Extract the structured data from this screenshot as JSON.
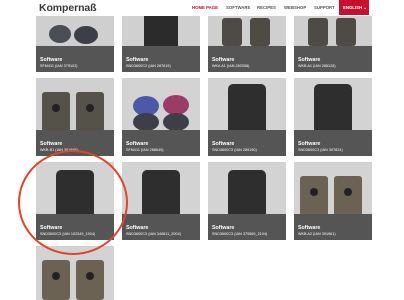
{
  "header": {
    "logo": "Kompernaß",
    "nav": [
      "HOME PAGE",
      "SOFTWARE",
      "RECIPES",
      "WEBSHOP",
      "SUPPORT"
    ],
    "language": "ENGLISH ⌄"
  },
  "tiles": [
    {
      "title": "Software",
      "subtitle": "SFM411 (IAN 379102)",
      "icon": "mouse-icon"
    },
    {
      "title": "Software",
      "subtitle": "SND3600C2 (IAN 287615)",
      "icon": "nas-icon"
    },
    {
      "title": "Software",
      "subtitle": "WKA A1 (IAN 282058)",
      "icon": "trail-camera-icon"
    },
    {
      "title": "Software",
      "subtitle": "WKB A1 (IAN 285128)",
      "icon": "trail-camera-icon"
    },
    {
      "title": "Software",
      "subtitle": "WKB B1 (IAN 301695)",
      "icon": "trail-camera-icon"
    },
    {
      "title": "Software",
      "subtitle": "SFM411 (IAN 288640)",
      "icon": "mouse-icon"
    },
    {
      "title": "Software",
      "subtitle": "SND3600C3 (IAN 289190)",
      "icon": "nas-icon"
    },
    {
      "title": "Software",
      "subtitle": "SND3600C3 (IAN 307824)",
      "icon": "nas-icon"
    },
    {
      "title": "Software",
      "subtitle": "SND3600C3 (IAN 102349_1904)",
      "icon": "nas-icon"
    },
    {
      "title": "Software",
      "subtitle": "SND3600C3 (IAN 340811_2004)",
      "icon": "nas-icon"
    },
    {
      "title": "Software",
      "subtitle": "SND3600C3 (IAN 375569_2104)",
      "icon": "nas-icon"
    },
    {
      "title": "Software",
      "subtitle": "WKB A2 (IAN 391961)",
      "icon": "trail-camera-icon"
    },
    {
      "title": "",
      "subtitle": "",
      "icon": "trail-camera-icon"
    }
  ]
}
